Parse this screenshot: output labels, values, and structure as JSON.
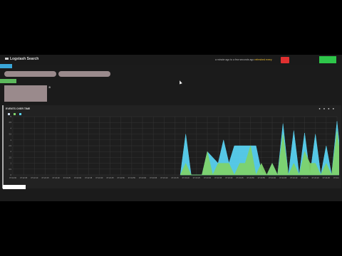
{
  "app": {
    "title": "Logstash Search",
    "time_range_text": "a minute ago to a few seconds ago",
    "refresh_text": "refreshed every",
    "refresh_highlight": "",
    "alert_text": ""
  },
  "toolbar": {
    "blue_button_label": "",
    "green_tag_label": ""
  },
  "queries": [
    {
      "text": "",
      "count": ""
    },
    {
      "text": "",
      "count": ""
    }
  ],
  "filter": {
    "lines": [
      "",
      "",
      "",
      ""
    ],
    "close_icon": "close-icon"
  },
  "panel": {
    "title": "EVENTS OVER TIME",
    "legend": [
      {
        "label": "",
        "color": "#c8d7e8"
      },
      {
        "label": "",
        "color": "#7ed36b"
      },
      {
        "label": "",
        "color": "#59d1f0"
      }
    ],
    "legend_note": ""
  },
  "colors": {
    "accent": "#3aa6d8",
    "green": "#7ed36b",
    "cyan": "#59d1f0"
  },
  "chart_data": {
    "type": "area",
    "x": [
      "07:22:00",
      "07:22:05",
      "07:22:10",
      "07:22:15",
      "07:22:20",
      "07:22:25",
      "07:22:30",
      "07:22:35",
      "07:22:40",
      "07:22:45",
      "07:22:50",
      "07:22:55",
      "07:23:00",
      "07:23:05",
      "07:23:10",
      "07:23:15",
      "07:23:20",
      "07:23:25",
      "07:23:30",
      "07:23:35",
      "07:23:40",
      "07:23:45",
      "07:23:50",
      "07:23:55",
      "07:24:00",
      "07:24:05",
      "07:24:10",
      "07:24:15",
      "07:24:20",
      "07:24:25",
      "07:24:30"
    ],
    "yticks": [
      "0",
      "0.5",
      "1",
      "1.5",
      "2",
      "2.5",
      "3",
      "3.5",
      "4",
      "4.5",
      "5"
    ],
    "ylim": [
      0,
      5
    ],
    "series": [
      {
        "color": "#59d1f0",
        "points": [
          [
            15.5,
            0
          ],
          [
            16,
            3.5
          ],
          [
            16.5,
            0
          ],
          [
            17.5,
            0
          ],
          [
            18,
            2
          ],
          [
            19,
            1
          ],
          [
            19.5,
            3
          ],
          [
            20,
            1
          ],
          [
            20.5,
            2.5
          ],
          [
            22.5,
            2.5
          ],
          [
            23,
            0.3
          ],
          [
            23.5,
            0
          ],
          [
            24,
            1
          ],
          [
            24.5,
            0
          ],
          [
            25,
            4.4
          ],
          [
            25.5,
            0
          ],
          [
            26,
            3.8
          ],
          [
            26.5,
            0
          ],
          [
            27,
            3.6
          ],
          [
            27.5,
            0
          ],
          [
            28,
            3.5
          ],
          [
            28.5,
            0
          ],
          [
            29,
            2.5
          ],
          [
            29.5,
            0
          ],
          [
            30,
            4.6
          ],
          [
            30.5,
            0
          ]
        ]
      },
      {
        "color": "#7ed36b",
        "points": [
          [
            15.5,
            0
          ],
          [
            16,
            1
          ],
          [
            16.5,
            0
          ],
          [
            17.5,
            0
          ],
          [
            18,
            2
          ],
          [
            18.5,
            0
          ],
          [
            19,
            1
          ],
          [
            20,
            1
          ],
          [
            20.5,
            0
          ],
          [
            21,
            1
          ],
          [
            21.5,
            1
          ],
          [
            22,
            2.5
          ],
          [
            22.5,
            0
          ],
          [
            23,
            1
          ],
          [
            23.5,
            0
          ],
          [
            24,
            1
          ],
          [
            24.5,
            0
          ],
          [
            25,
            3.5
          ],
          [
            25.5,
            0
          ],
          [
            26,
            1
          ],
          [
            26.5,
            0
          ],
          [
            27,
            2
          ],
          [
            27.5,
            1
          ],
          [
            28,
            1
          ],
          [
            28.5,
            0
          ],
          [
            29,
            1
          ],
          [
            29.5,
            0
          ],
          [
            30,
            3.8
          ],
          [
            30.5,
            0
          ]
        ]
      }
    ]
  }
}
